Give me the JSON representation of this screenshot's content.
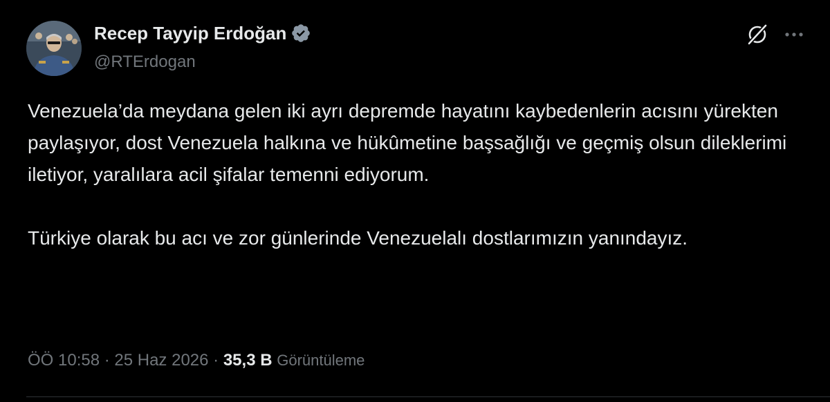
{
  "author": {
    "display_name": "Recep Tayyip Erdoğan",
    "handle": "@RTErdogan",
    "verified": true,
    "verified_badge_color": "#8b98a5"
  },
  "tweet": {
    "paragraphs": [
      "Venezuela’da meydana gelen iki ayrı depremde hayatını kaybedenlerin acısını yürekten paylaşıyor, dost Venezuela halkına ve hükûmetine başsağlığı ve geçmiş olsun dileklerimi iletiyor, yaralılara acil şifalar temenni ediyorum.",
      "Türkiye olarak bu acı ve zor günlerinde Venezuelalı dostlarımızın yanındayız."
    ]
  },
  "meta": {
    "time": "ÖÖ 10:58",
    "separator": " · ",
    "date": "25 Haz 2026",
    "views_count": "35,3 B",
    "views_label": "Görüntüleme"
  },
  "icons": {
    "avatar": "avatar-photo",
    "verified": "verified-badge-icon",
    "grok": "grok-icon",
    "more": "more-options-icon"
  },
  "colors": {
    "background": "#000000",
    "primary_text": "#e7e9ea",
    "secondary_text": "#71767b",
    "divider": "#2f3336"
  }
}
